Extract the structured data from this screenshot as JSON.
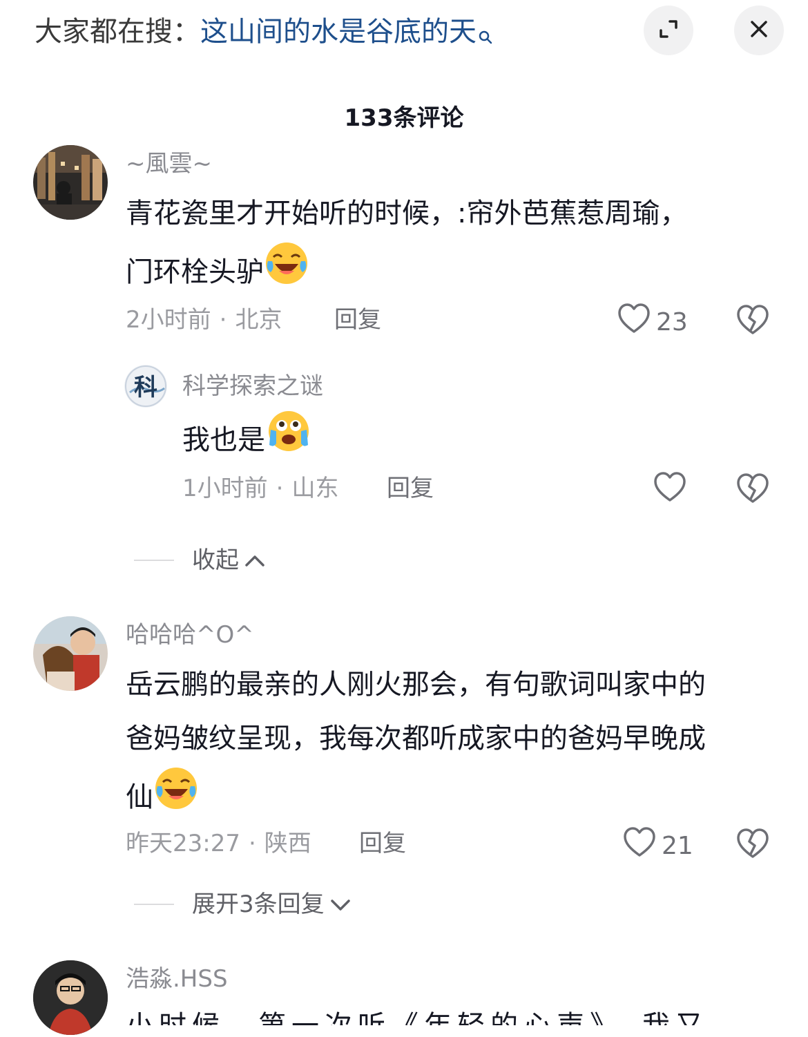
{
  "top_bar": {
    "search_prefix": "大家都在搜：",
    "search_term": "这山间的水是谷底的天",
    "expand_icon": "expand-icon",
    "close_icon": "close-icon"
  },
  "comments_header": {
    "count_label": "133条评论"
  },
  "comments": [
    {
      "username": "~風雲~",
      "content_lines": [
        "青花瓷里才开始听的时候，:帘外芭蕉惹周瑜，",
        "门环栓头驴"
      ],
      "emoji": "laugh-cry-emoji",
      "time": "2小时前",
      "location": "北京",
      "reply_label": "回复",
      "like_count": "23",
      "replies": [
        {
          "username": "科学探索之谜",
          "avatar_text": "科",
          "content": "我也是",
          "emoji": "crying-emoji",
          "time": "1小时前",
          "location": "山东",
          "reply_label": "回复"
        }
      ],
      "collapse_label": "收起"
    },
    {
      "username": "哈哈哈^O^",
      "content_lines": [
        "岳云鹏的最亲的人刚火那会，有句歌词叫家中的",
        "爸妈皱纹呈现，我每次都听成家中的爸妈早晚成",
        "仙"
      ],
      "emoji": "laugh-cry-emoji",
      "time": "昨天23:27",
      "location": "陕西",
      "reply_label": "回复",
      "like_count": "21",
      "expand_label": "展开3条回复"
    },
    {
      "username": "浩淼.HSS",
      "content_partial": "小时候，第一次听《年轻的心声》，我又"
    }
  ],
  "colors": {
    "link_blue": "#1e4f8c",
    "meta_gray": "#9a9ba0",
    "text_dark": "#161823"
  }
}
